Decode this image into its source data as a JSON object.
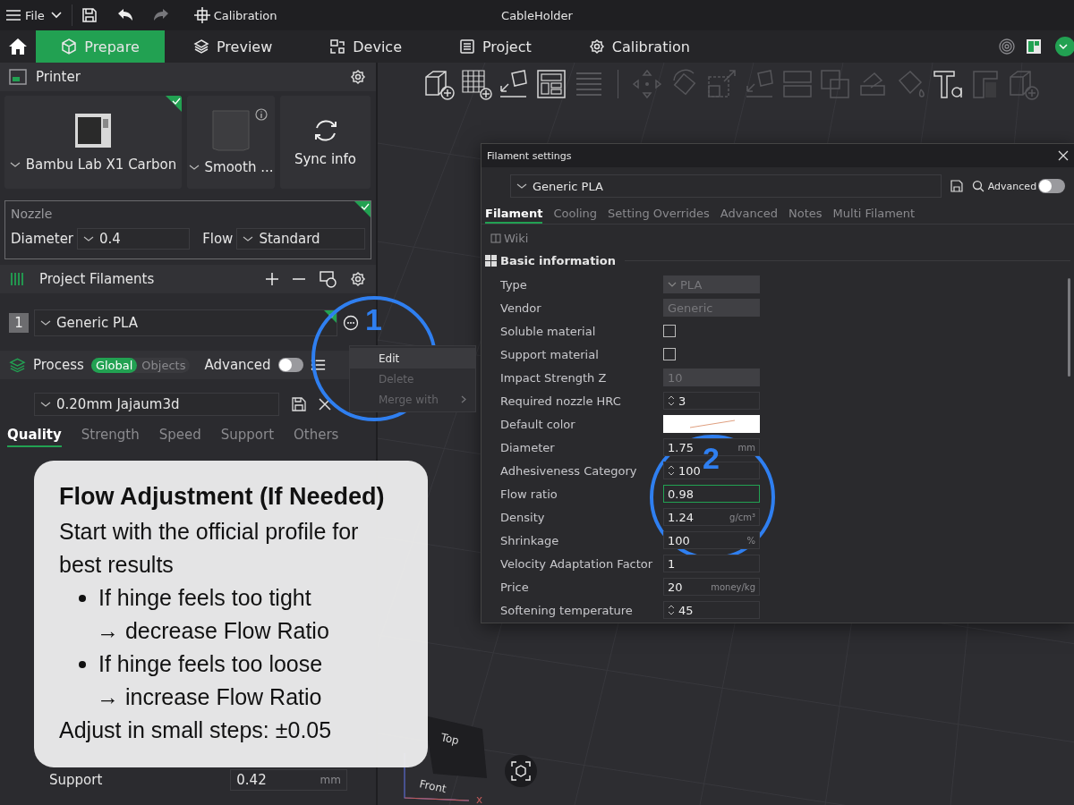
{
  "title_bar": {
    "menu": "File",
    "quick_action": "Calibration",
    "document_title": "CableHolder"
  },
  "tabs": [
    {
      "label": "Prepare",
      "selected": true
    },
    {
      "label": "Preview",
      "selected": false
    },
    {
      "label": "Device",
      "selected": false
    },
    {
      "label": "Project",
      "selected": false
    },
    {
      "label": "Calibration",
      "selected": false
    }
  ],
  "printer": {
    "title": "Printer",
    "printer_name": "Bambu Lab X1 Carbon",
    "plate": "Smooth ...",
    "sync": "Sync info"
  },
  "nozzle": {
    "title": "Nozzle",
    "diameter_label": "Diameter",
    "diameter": "0.4",
    "flow_label": "Flow",
    "flow": "Standard"
  },
  "filaments": {
    "title": "Project Filaments",
    "items": [
      {
        "index": "1",
        "name": "Generic PLA"
      }
    ]
  },
  "context_menu": [
    {
      "label": "Edit",
      "disabled": false,
      "submenu": false
    },
    {
      "label": "Delete",
      "disabled": true,
      "submenu": false
    },
    {
      "label": "Merge with",
      "disabled": true,
      "submenu": true
    }
  ],
  "process": {
    "title": "Process",
    "scopes": [
      {
        "label": "Global",
        "selected": true
      },
      {
        "label": "Objects",
        "selected": false
      }
    ],
    "advanced_label": "Advanced",
    "advanced_on": false,
    "preset": "0.20mm Jajaum3d",
    "tabs": [
      {
        "label": "Quality",
        "selected": true
      },
      {
        "label": "Strength",
        "selected": false
      },
      {
        "label": "Speed",
        "selected": false
      },
      {
        "label": "Support",
        "selected": false
      },
      {
        "label": "Others",
        "selected": false
      }
    ],
    "rows": [
      {
        "label": "Support",
        "value": "0.42",
        "unit": "mm"
      }
    ]
  },
  "tip_card": {
    "title": "Flow Adjustment (If Needed)",
    "intro": "Start with the official profile for best results",
    "bullets": [
      {
        "text": "If hinge feels too tight",
        "result": "→ decrease Flow Ratio"
      },
      {
        "text": "If hinge feels too loose",
        "result": "→ increase Flow Ratio"
      }
    ],
    "footer": "Adjust in small steps: ±0.05"
  },
  "toolbar_groups": [
    [
      {
        "kind": "add-cube",
        "disabled": false
      },
      {
        "kind": "add-plate",
        "disabled": false
      },
      {
        "kind": "orient",
        "disabled": false
      },
      {
        "kind": "arrange",
        "disabled": false
      },
      {
        "kind": "lines",
        "disabled": true
      }
    ],
    [
      {
        "kind": "move",
        "disabled": true
      },
      {
        "kind": "rotate",
        "disabled": true
      },
      {
        "kind": "scale",
        "disabled": true
      },
      {
        "kind": "orient",
        "disabled": true
      },
      {
        "kind": "split",
        "disabled": true
      },
      {
        "kind": "boolean",
        "disabled": true
      },
      {
        "kind": "cut",
        "disabled": true
      },
      {
        "kind": "paint",
        "disabled": true
      },
      {
        "kind": "text",
        "disabled": false
      },
      {
        "kind": "seam",
        "disabled": true
      },
      {
        "kind": "add-cube",
        "disabled": true
      }
    ]
  ],
  "view_cube": {
    "top": "Top",
    "front": "Front",
    "axis": "x"
  },
  "filament_dialog": {
    "title": "Filament settings",
    "preset": "Generic PLA",
    "advanced_label": "Advanced",
    "advanced_on": false,
    "tabs": [
      {
        "label": "Filament",
        "selected": true
      },
      {
        "label": "Cooling",
        "selected": false
      },
      {
        "label": "Setting Overrides",
        "selected": false
      },
      {
        "label": "Advanced",
        "selected": false
      },
      {
        "label": "Notes",
        "selected": false
      },
      {
        "label": "Multi Filament",
        "selected": false
      }
    ],
    "wiki": "Wiki",
    "section": "Basic information",
    "rows": [
      {
        "label": "Type",
        "kind": "select",
        "value": "PLA",
        "disabled": true,
        "focused": false
      },
      {
        "label": "Vendor",
        "kind": "text",
        "value": "Generic",
        "disabled": true,
        "focused": false
      },
      {
        "label": "Soluble material",
        "kind": "checkbox",
        "checked": false
      },
      {
        "label": "Support material",
        "kind": "checkbox",
        "checked": false
      },
      {
        "label": "Impact Strength Z",
        "kind": "text",
        "value": "10",
        "disabled": true,
        "focused": false
      },
      {
        "label": "Required nozzle HRC",
        "kind": "spin",
        "value": "3",
        "disabled": false,
        "focused": false
      },
      {
        "label": "Default color",
        "kind": "color"
      },
      {
        "label": "Diameter",
        "kind": "text",
        "value": "1.75",
        "unit": "mm",
        "disabled": false,
        "focused": false
      },
      {
        "label": "Adhesiveness Category",
        "kind": "spin",
        "value": "100",
        "disabled": false,
        "focused": false
      },
      {
        "label": "Flow ratio",
        "kind": "text",
        "value": "0.98",
        "disabled": false,
        "focused": true
      },
      {
        "label": "Density",
        "kind": "text",
        "value": "1.24",
        "unit": "g/cm³",
        "disabled": false,
        "focused": false
      },
      {
        "label": "Shrinkage",
        "kind": "text",
        "value": "100",
        "unit": "%",
        "disabled": false,
        "focused": false
      },
      {
        "label": "Velocity Adaptation Factor",
        "kind": "text",
        "value": "1",
        "disabled": false,
        "focused": false
      },
      {
        "label": "Price",
        "kind": "text",
        "value": "20",
        "unit": "money/kg",
        "disabled": false,
        "focused": false
      },
      {
        "label": "Softening temperature",
        "kind": "spin",
        "value": "45",
        "disabled": false,
        "focused": false
      }
    ]
  },
  "annotations": [
    {
      "number": "1"
    },
    {
      "number": "2"
    }
  ]
}
